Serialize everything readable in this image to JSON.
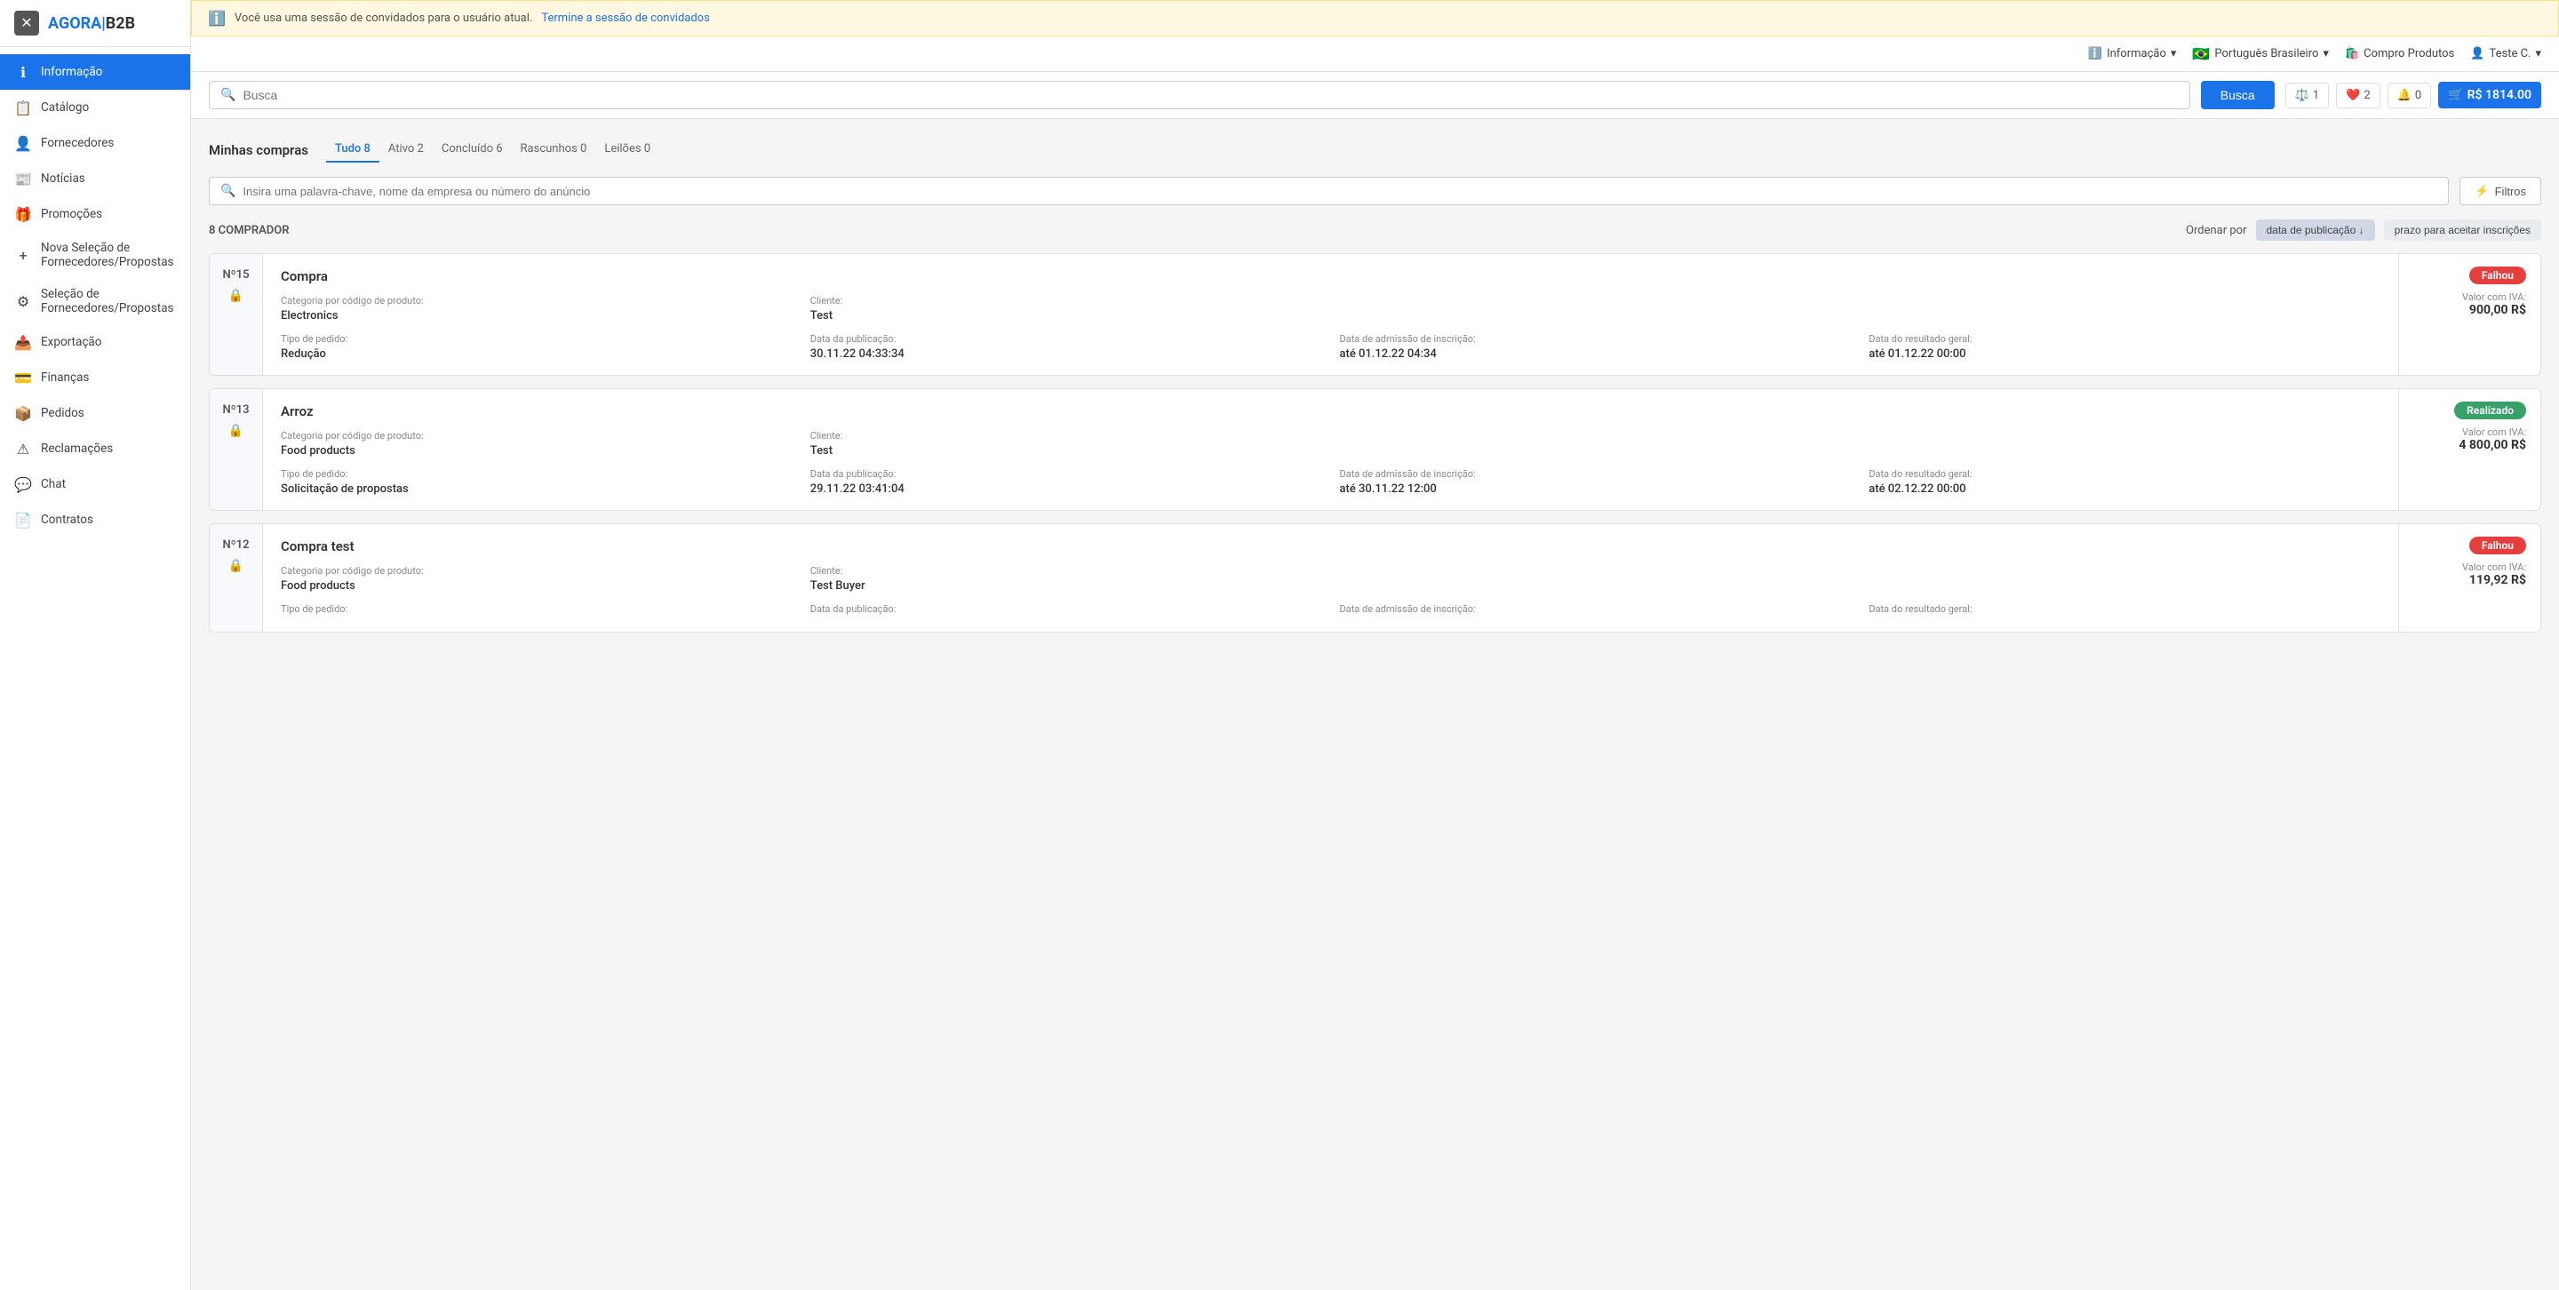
{
  "sidebar": {
    "close_label": "✕",
    "logo": "AGORA|B2B",
    "items": [
      {
        "id": "informacao",
        "label": "Informação",
        "icon": "ℹ",
        "active": true
      },
      {
        "id": "catalogo",
        "label": "Catálogo",
        "icon": "📋",
        "active": false
      },
      {
        "id": "fornecedores",
        "label": "Fornecedores",
        "icon": "👤",
        "active": false
      },
      {
        "id": "noticias",
        "label": "Notícias",
        "icon": "📰",
        "active": false
      },
      {
        "id": "promocoes",
        "label": "Promoções",
        "icon": "🎁",
        "active": false
      },
      {
        "id": "nova-selecao",
        "label": "Nova Seleção de Fornecedores/Propostas",
        "icon": "+",
        "active": false
      },
      {
        "id": "selecao",
        "label": "Seleção de Fornecedores/Propostas",
        "icon": "⚙",
        "active": false
      },
      {
        "id": "exportacao",
        "label": "Exportação",
        "icon": "📤",
        "active": false
      },
      {
        "id": "financas",
        "label": "Finanças",
        "icon": "💳",
        "active": false
      },
      {
        "id": "pedidos",
        "label": "Pedidos",
        "icon": "📦",
        "active": false
      },
      {
        "id": "reclamacoes",
        "label": "Reclamações",
        "icon": "⚠",
        "active": false
      },
      {
        "id": "chat",
        "label": "Chat",
        "icon": "💬",
        "active": false
      },
      {
        "id": "contratos",
        "label": "Contratos",
        "icon": "📄",
        "active": false
      }
    ]
  },
  "banner": {
    "icon": "ℹ",
    "text": "Você usa uma sessão de convidados para o usuário atual.",
    "link_text": "Termine a sessão de convidados"
  },
  "top_header": {
    "info_label": "Informação",
    "language_flag": "🇧🇷",
    "language_label": "Português Brasileiro",
    "shop_icon": "🛍",
    "shop_label": "Compro Produtos",
    "user_icon": "👤",
    "user_label": "Teste C."
  },
  "search_bar": {
    "placeholder": "Busca",
    "button_label": "Busca",
    "compare_count": "1",
    "favorite_count": "2",
    "notification_count": "0",
    "cart_amount": "R$ 1814.00"
  },
  "minhas_compras": {
    "title": "Minhas compras",
    "tabs": [
      {
        "id": "tudo",
        "label": "Tudo",
        "count": "8",
        "active": true
      },
      {
        "id": "ativo",
        "label": "Ativo",
        "count": "2",
        "active": false
      },
      {
        "id": "concluido",
        "label": "Concluído",
        "count": "6",
        "active": false
      },
      {
        "id": "rascunhos",
        "label": "Rascunhos",
        "count": "0",
        "active": false
      },
      {
        "id": "leiloes",
        "label": "Leilões",
        "count": "0",
        "active": false
      }
    ],
    "filter_placeholder": "Insira uma palavra-chave, nome da empresa ou número do anúncio",
    "filter_button": "Filtros",
    "results_count": "8 COMPRADOR",
    "sort_label": "Ordenar por",
    "sort_options": [
      "data de publicação ↓",
      "prazo para aceitar inscrições"
    ]
  },
  "purchases": [
    {
      "id": "p15",
      "number": "Nº15",
      "title": "Compra",
      "status": "Falhou",
      "status_type": "failed",
      "category_label": "Categoria por código de produto:",
      "category_value": "Electronics",
      "client_label": "Cliente:",
      "client_value": "Test",
      "type_label": "Tipo de pedido:",
      "type_value": "Redução",
      "pub_date_label": "Data da publicação:",
      "pub_date_value": "30.11.22 04:33:34",
      "admission_label": "Data de admissão de inscrição:",
      "admission_value": "até 01.12.22 04:34",
      "result_label": "Data do resultado geral:",
      "result_value": "até 01.12.22 00:00",
      "value_label": "Valor com IVA:",
      "value_amount": "900,00 R$"
    },
    {
      "id": "p13",
      "number": "Nº13",
      "title": "Arroz",
      "status": "Realizado",
      "status_type": "success",
      "category_label": "Categoria por código de produto:",
      "category_value": "Food products",
      "client_label": "Cliente:",
      "client_value": "Test",
      "type_label": "Tipo de pedido:",
      "type_value": "Solicitação de propostas",
      "pub_date_label": "Data da publicação:",
      "pub_date_value": "29.11.22 03:41:04",
      "admission_label": "Data de admissão de inscrição:",
      "admission_value": "até 30.11.22 12:00",
      "result_label": "Data do resultado geral:",
      "result_value": "até 02.12.22 00:00",
      "value_label": "Valor com IVA:",
      "value_amount": "4 800,00 R$"
    },
    {
      "id": "p12",
      "number": "Nº12",
      "title": "Compra test",
      "status": "Falhou",
      "status_type": "failed",
      "category_label": "Categoria por código de produto:",
      "category_value": "Food products",
      "client_label": "Cliente:",
      "client_value": "Test Buyer",
      "type_label": "Tipo de pedido:",
      "type_value": "",
      "pub_date_label": "Data da publicação:",
      "pub_date_value": "",
      "admission_label": "Data de admissão de inscrição:",
      "admission_value": "",
      "result_label": "Data do resultado geral:",
      "result_value": "",
      "value_label": "Valor com IVA:",
      "value_amount": "119,92 R$"
    }
  ]
}
